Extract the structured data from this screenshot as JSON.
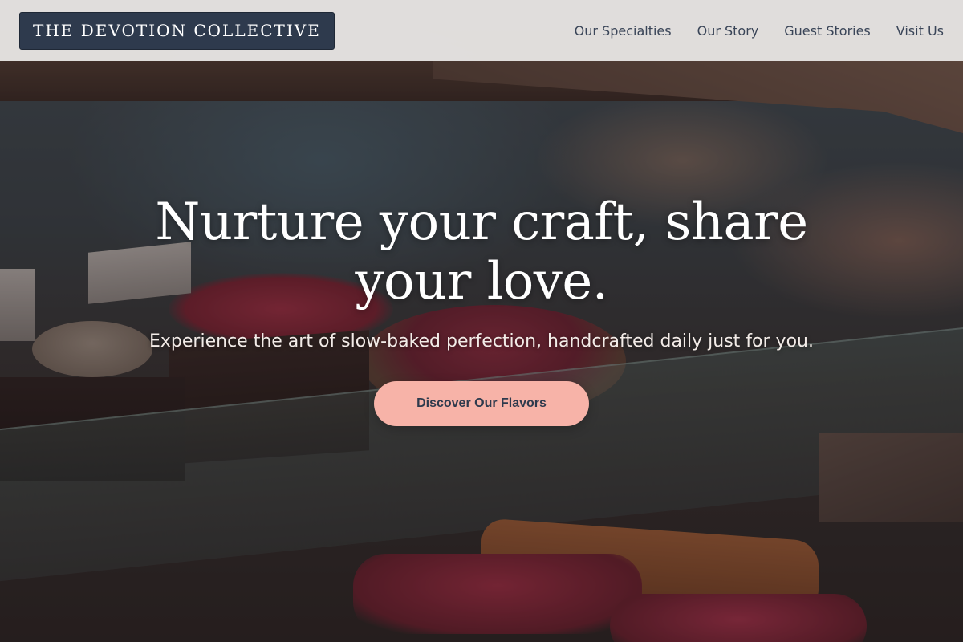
{
  "header": {
    "logo_text": "THE DEVOTION COLLECTIVE",
    "nav": [
      {
        "label": "Our Specialties"
      },
      {
        "label": "Our Story"
      },
      {
        "label": "Guest Stories"
      },
      {
        "label": "Visit Us"
      }
    ]
  },
  "hero": {
    "title": "Nurture your craft, share your love.",
    "subtitle": "Experience the art of slow-baked perfection, handcrafted daily just for you.",
    "cta_label": "Discover Our Flavors"
  },
  "colors": {
    "logo_background": "#2e3a4d",
    "cta_background": "#f7b3a8",
    "nav_text": "#3a4558"
  }
}
